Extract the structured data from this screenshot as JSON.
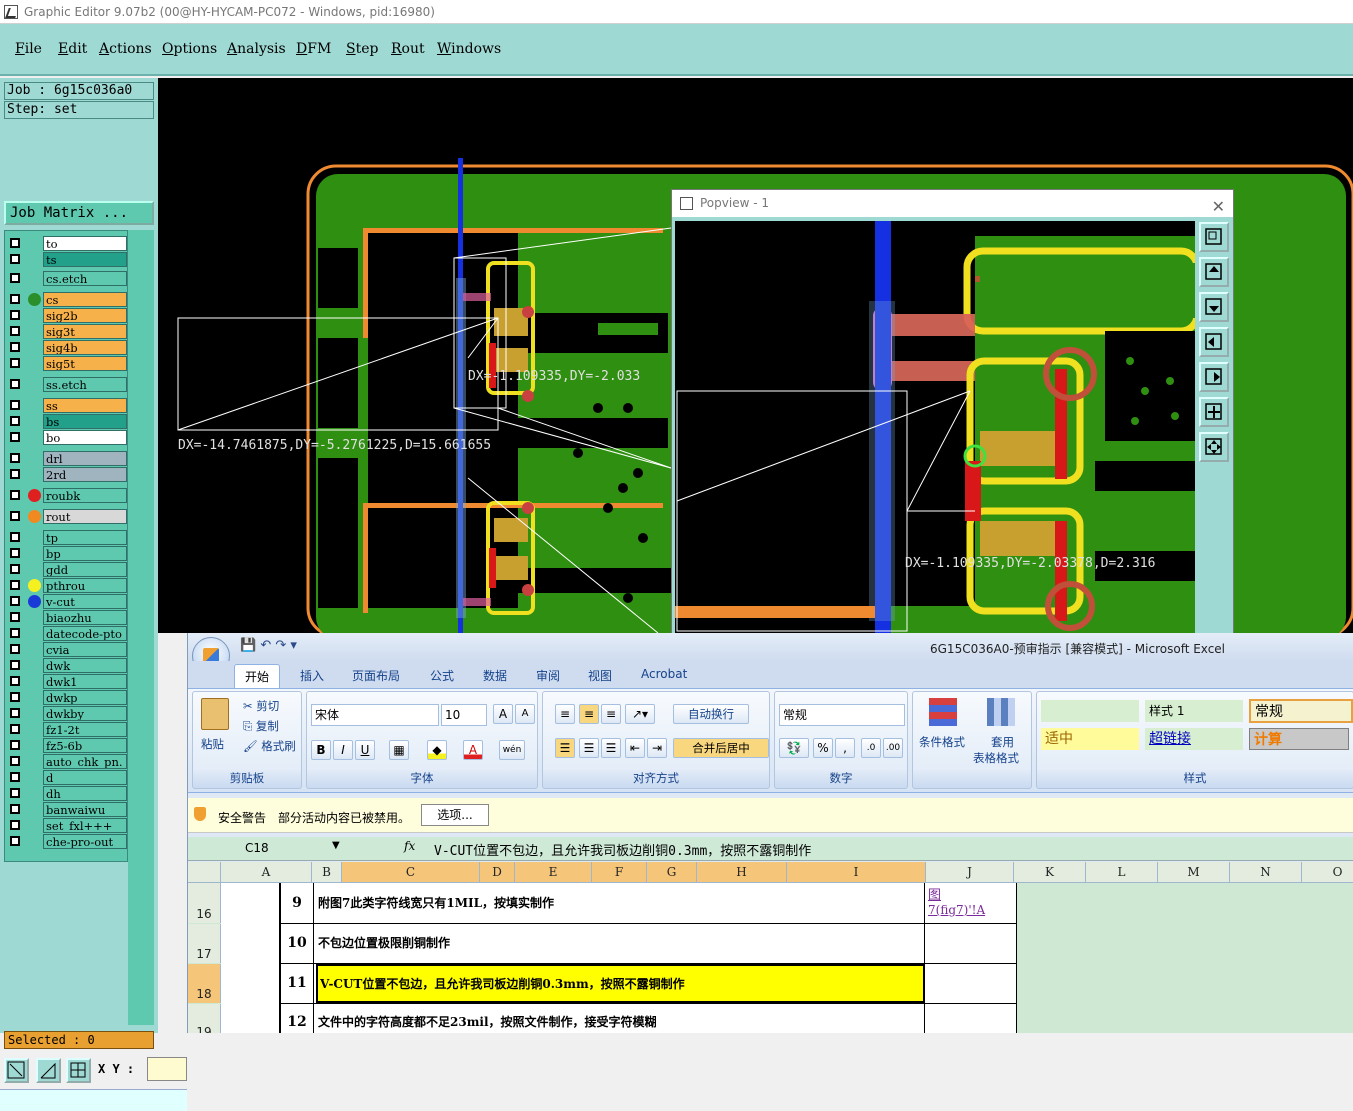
{
  "window": {
    "title": "Graphic Editor 9.07b2 (00@HY-HYCAM-PC072 - Windows, pid:16980)"
  },
  "menu": [
    "File",
    "Edit",
    "Actions",
    "Options",
    "Analysis",
    "DFM",
    "Step",
    "Rout",
    "Windows"
  ],
  "job": {
    "job_label": "Job : 6g15c036a0",
    "step_label": "Step: set",
    "matrix_button": "Job Matrix ..."
  },
  "layers": [
    {
      "name": "to",
      "color": "#ffffff",
      "dot": ""
    },
    {
      "name": "ts",
      "color": "#22a08a",
      "dot": ""
    },
    {
      "name": "cs.etch",
      "color": "#5fc9b0",
      "dot": ""
    },
    {
      "name": "cs",
      "color": "#f7b14a",
      "dot": "#2a8f2a"
    },
    {
      "name": "sig2b",
      "color": "#f7b14a",
      "dot": ""
    },
    {
      "name": "sig3t",
      "color": "#f7b14a",
      "dot": ""
    },
    {
      "name": "sig4b",
      "color": "#f7b14a",
      "dot": ""
    },
    {
      "name": "sig5t",
      "color": "#f7b14a",
      "dot": ""
    },
    {
      "name": "ss.etch",
      "color": "#5fc9b0",
      "dot": ""
    },
    {
      "name": "ss",
      "color": "#f7b14a",
      "dot": ""
    },
    {
      "name": "bs",
      "color": "#22a08a",
      "dot": ""
    },
    {
      "name": "bo",
      "color": "#ffffff",
      "dot": ""
    },
    {
      "name": "drl",
      "color": "#a0b4c0",
      "dot": ""
    },
    {
      "name": "2rd",
      "color": "#a0b4c0",
      "dot": ""
    },
    {
      "name": "roubk",
      "color": "#5fc9b0",
      "dot": "#e02020"
    },
    {
      "name": "rout",
      "color": "#d8d8d8",
      "dot": "#f08a20"
    },
    {
      "name": "tp",
      "color": "#5fc9b0",
      "dot": ""
    },
    {
      "name": "bp",
      "color": "#5fc9b0",
      "dot": ""
    },
    {
      "name": "gdd",
      "color": "#5fc9b0",
      "dot": ""
    },
    {
      "name": "pthrou",
      "color": "#5fc9b0",
      "dot": "#f5f020"
    },
    {
      "name": "v-cut",
      "color": "#5fc9b0",
      "dot": "#1a3ad8"
    },
    {
      "name": "biaozhu",
      "color": "#5fc9b0",
      "dot": ""
    },
    {
      "name": "datecode-pto",
      "color": "#5fc9b0",
      "dot": ""
    },
    {
      "name": "cvia",
      "color": "#5fc9b0",
      "dot": ""
    },
    {
      "name": "dwk",
      "color": "#5fc9b0",
      "dot": ""
    },
    {
      "name": "dwk1",
      "color": "#5fc9b0",
      "dot": ""
    },
    {
      "name": "dwkp",
      "color": "#5fc9b0",
      "dot": ""
    },
    {
      "name": "dwkby",
      "color": "#5fc9b0",
      "dot": ""
    },
    {
      "name": "fz1-2t",
      "color": "#5fc9b0",
      "dot": ""
    },
    {
      "name": "fz5-6b",
      "color": "#5fc9b0",
      "dot": ""
    },
    {
      "name": "auto_chk_pn.",
      "color": "#5fc9b0",
      "dot": ""
    },
    {
      "name": "d",
      "color": "#5fc9b0",
      "dot": ""
    },
    {
      "name": "dh",
      "color": "#5fc9b0",
      "dot": ""
    },
    {
      "name": "banwaiwu",
      "color": "#5fc9b0",
      "dot": ""
    },
    {
      "name": "set_fxl+++",
      "color": "#5fc9b0",
      "dot": ""
    },
    {
      "name": "che-pro-out",
      "color": "#5fc9b0",
      "dot": ""
    }
  ],
  "status": {
    "selected": "Selected : 0",
    "xy_label": "X Y :"
  },
  "canvas": {
    "measure_1": "DX=-14.7461875,DY=-5.2761225,D=15.661655",
    "measure_2": "DX=-1.109335,DY=-2.033",
    "popview_measure": "DX=-1.109335,DY=-2.03378,D=2.316"
  },
  "popview": {
    "title": "Popview - 1",
    "close": "✕"
  },
  "excel": {
    "title": "6G15C036A0-预审指示  [兼容模式] - Microsoft Excel",
    "tabs": [
      "开始",
      "插入",
      "页面布局",
      "公式",
      "数据",
      "审阅",
      "视图",
      "Acrobat"
    ],
    "clipboard": {
      "paste": "粘贴",
      "cut": "剪切",
      "copy": "复制",
      "format_painter": "格式刷",
      "label": "剪贴板"
    },
    "font": {
      "name": "宋体",
      "size": "10",
      "label": "字体",
      "bold": "B",
      "italic": "I",
      "underline": "U",
      "grow": "A",
      "shrink": "A"
    },
    "align": {
      "wrap": "自动换行",
      "merge": "合并后居中",
      "label": "对齐方式"
    },
    "number": {
      "format": "常规",
      "percent": "%",
      "comma": ",",
      "label": "数字"
    },
    "cond": {
      "cond_fmt": "条件格式",
      "table_fmt_1": "套用",
      "table_fmt_2": "表格格式"
    },
    "styles": {
      "style1": "样式 1",
      "normal": "常规",
      "neutral": "适中",
      "hyperlink": "超链接",
      "calc": "计算",
      "label": "样式"
    },
    "security": {
      "warning": "安全警告",
      "message": "部分活动内容已被禁用。",
      "options": "选项..."
    },
    "formula_bar": {
      "name_box": "C18",
      "fx": "fx",
      "value": "V-CUT位置不包边，且允许我司板边削铜0.3mm，按照不露铜制作"
    },
    "columns": [
      "A",
      "B",
      "C",
      "D",
      "E",
      "F",
      "G",
      "H",
      "I",
      "J",
      "K",
      "L",
      "M",
      "N",
      "O"
    ],
    "rows": [
      {
        "row": "16",
        "num": "9",
        "text": "附图7此类字符线宽只有1MIL，按填实制作",
        "link_1": "图",
        "link_2": "7(fig7)'!A"
      },
      {
        "row": "17",
        "num": "10",
        "text": "不包边位置极限削铜制作",
        "link_1": "",
        "link_2": ""
      },
      {
        "row": "18",
        "num": "11",
        "text": "V-CUT位置不包边，且允许我司板边削铜0.3mm，按照不露铜制作",
        "link_1": "",
        "link_2": ""
      },
      {
        "row": "19",
        "num": "12",
        "text": "文件中的字符高度都不足23mil，按照文件制作，接受字符模糊",
        "link_1": "",
        "link_2": ""
      }
    ]
  }
}
